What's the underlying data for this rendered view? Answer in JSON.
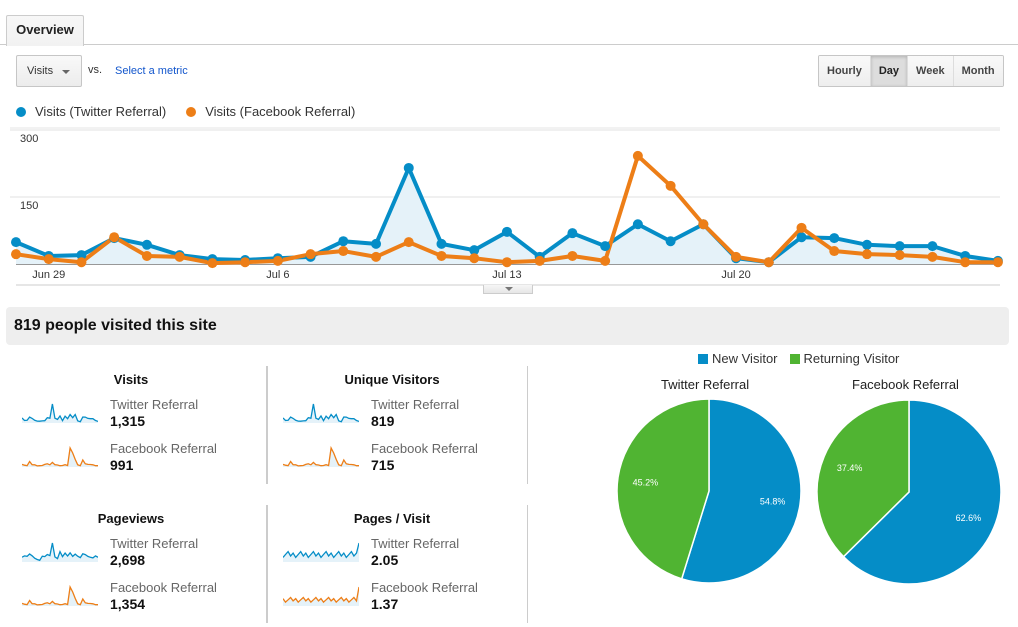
{
  "tabs": [
    {
      "label": "Overview",
      "active": true
    }
  ],
  "controls": {
    "metric_select": "Visits",
    "vs_label": "vs.",
    "select_metric_link": "Select a metric",
    "granularity": [
      {
        "label": "Hourly",
        "active": false
      },
      {
        "label": "Day",
        "active": true
      },
      {
        "label": "Week",
        "active": false
      },
      {
        "label": "Month",
        "active": false
      }
    ]
  },
  "colors": {
    "twitter": "#058dc7",
    "facebook": "#ed7e17",
    "new_visitor": "#058dc7",
    "returning_visitor": "#50b432",
    "area_fill": "#e5f2f9"
  },
  "chart_data": [
    {
      "type": "line",
      "title": "",
      "legend_position": "top-left",
      "yticks": [
        150,
        300
      ],
      "ylim": [
        0,
        300
      ],
      "xtick_labels": [
        {
          "index": 1,
          "label": "Jun 29"
        },
        {
          "index": 8,
          "label": "Jul 6"
        },
        {
          "index": 15,
          "label": "Jul 13"
        },
        {
          "index": 22,
          "label": "Jul 20"
        }
      ],
      "x": [
        "Jun 28",
        "Jun 29",
        "Jun 30",
        "Jul 1",
        "Jul 2",
        "Jul 3",
        "Jul 4",
        "Jul 5",
        "Jul 6",
        "Jul 7",
        "Jul 8",
        "Jul 9",
        "Jul 10",
        "Jul 11",
        "Jul 12",
        "Jul 13",
        "Jul 14",
        "Jul 15",
        "Jul 16",
        "Jul 17",
        "Jul 18",
        "Jul 19",
        "Jul 20",
        "Jul 21",
        "Jul 22",
        "Jul 23",
        "Jul 24",
        "Jul 25",
        "Jul 26",
        "Jul 27",
        "Jul 28"
      ],
      "series": [
        {
          "name": "Visits (Twitter Referral)",
          "values": [
            49,
            18,
            20,
            58,
            43,
            20,
            11,
            9,
            13,
            16,
            51,
            45,
            215,
            45,
            31,
            72,
            16,
            69,
            40,
            89,
            51,
            89,
            13,
            4,
            60,
            58,
            43,
            40,
            40,
            18,
            7
          ]
        },
        {
          "name": "Visits (Facebook Referral)",
          "values": [
            22,
            11,
            4,
            60,
            18,
            16,
            2,
            4,
            7,
            22,
            29,
            16,
            49,
            18,
            13,
            4,
            7,
            18,
            7,
            242,
            175,
            89,
            16,
            4,
            81,
            29,
            22,
            20,
            16,
            4,
            4
          ]
        }
      ]
    },
    {
      "type": "pie",
      "title": "Twitter Referral",
      "slices": [
        {
          "label": "New Visitor",
          "value": 54.8
        },
        {
          "label": "Returning Visitor",
          "value": 45.2
        }
      ]
    },
    {
      "type": "pie",
      "title": "Facebook Referral",
      "slices": [
        {
          "label": "New Visitor",
          "value": 62.6
        },
        {
          "label": "Returning Visitor",
          "value": 37.4
        }
      ]
    }
  ],
  "summary": {
    "headline": "819 people visited this site",
    "kpis": [
      {
        "title": "Visits",
        "rows": [
          {
            "label": "Twitter Referral",
            "value": "1,315"
          },
          {
            "label": "Facebook Referral",
            "value": "991"
          }
        ]
      },
      {
        "title": "Unique Visitors",
        "rows": [
          {
            "label": "Twitter Referral",
            "value": "819"
          },
          {
            "label": "Facebook Referral",
            "value": "715"
          }
        ]
      },
      {
        "title": "Pageviews",
        "rows": [
          {
            "label": "Twitter Referral",
            "value": "2,698"
          },
          {
            "label": "Facebook Referral",
            "value": "1,354"
          }
        ]
      },
      {
        "title": "Pages / Visit",
        "rows": [
          {
            "label": "Twitter Referral",
            "value": "2.05"
          },
          {
            "label": "Facebook Referral",
            "value": "1.37"
          }
        ]
      }
    ],
    "pie_legend": [
      {
        "label": "New Visitor"
      },
      {
        "label": "Returning Visitor"
      }
    ]
  }
}
